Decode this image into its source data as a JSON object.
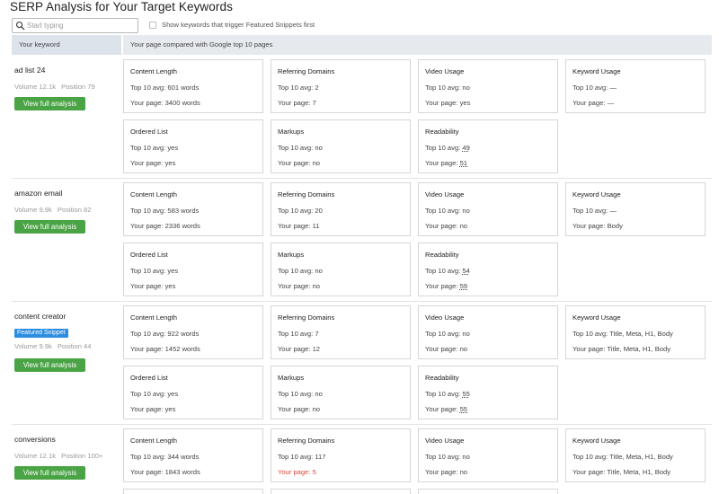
{
  "page": {
    "title": "SERP Analysis for Your Target Keywords",
    "search_placeholder": "Start typing",
    "featured_checkbox_label": "Show keywords that trigger Featured Snippets first"
  },
  "table_header": {
    "left": "Your keyword",
    "right": "Your page compared with Google top 10 pages"
  },
  "button_label": "View full analysis",
  "keywords": [
    {
      "name": "ad list 24",
      "volume": "Volume 12.1k",
      "position": "Position 79",
      "badge": "",
      "metrics": {
        "content_length": {
          "title": "Content Length",
          "avg": "Top 10 avg: 601 words",
          "page": "Your page: 3400 words"
        },
        "referring_domains": {
          "title": "Referring Domains",
          "avg": "Top 10 avg: 2",
          "page": "Your page: 7"
        },
        "video_usage": {
          "title": "Video Usage",
          "avg": "Top 10 avg: no",
          "page": "Your page: yes"
        },
        "keyword_usage": {
          "title": "Keyword Usage",
          "avg": "Top 10 avg: —",
          "page": "Your page: —"
        },
        "ordered_list": {
          "title": "Ordered List",
          "avg": "Top 10 avg: yes",
          "page": "Your page: yes"
        },
        "markups": {
          "title": "Markups",
          "avg": "Top 10 avg: no",
          "page": "Your page: no"
        },
        "readability": {
          "title": "Readability",
          "avg_prefix": "Top 10 avg: ",
          "avg_value": "49",
          "page_prefix": "Your page: ",
          "page_value": "51"
        }
      }
    },
    {
      "name": "amazon email",
      "volume": "Volume 9.9k",
      "position": "Position 82",
      "badge": "",
      "metrics": {
        "content_length": {
          "title": "Content Length",
          "avg": "Top 10 avg: 583 words",
          "page": "Your page: 2336 words"
        },
        "referring_domains": {
          "title": "Referring Domains",
          "avg": "Top 10 avg: 20",
          "page": "Your page: 11"
        },
        "video_usage": {
          "title": "Video Usage",
          "avg": "Top 10 avg: no",
          "page": "Your page: no"
        },
        "keyword_usage": {
          "title": "Keyword Usage",
          "avg": "Top 10 avg: —",
          "page": "Your page: Body"
        },
        "ordered_list": {
          "title": "Ordered List",
          "avg": "Top 10 avg: yes",
          "page": "Your page: yes"
        },
        "markups": {
          "title": "Markups",
          "avg": "Top 10 avg: no",
          "page": "Your page: no"
        },
        "readability": {
          "title": "Readability",
          "avg_prefix": "Top 10 avg: ",
          "avg_value": "54",
          "page_prefix": "Your page: ",
          "page_value": "59"
        }
      }
    },
    {
      "name": "content creator",
      "volume": "Volume 9.9k",
      "position": "Position 44",
      "badge": "Featured Snippet",
      "metrics": {
        "content_length": {
          "title": "Content Length",
          "avg": "Top 10 avg: 922 words",
          "page": "Your page: 1452 words"
        },
        "referring_domains": {
          "title": "Referring Domains",
          "avg": "Top 10 avg: 7",
          "page": "Your page: 12"
        },
        "video_usage": {
          "title": "Video Usage",
          "avg": "Top 10 avg: no",
          "page": "Your page: no"
        },
        "keyword_usage": {
          "title": "Keyword Usage",
          "avg": "Top 10 avg: Title, Meta, H1, Body",
          "page": "Your page: Title, Meta, H1, Body"
        },
        "ordered_list": {
          "title": "Ordered List",
          "avg": "Top 10 avg: yes",
          "page": "Your page: yes"
        },
        "markups": {
          "title": "Markups",
          "avg": "Top 10 avg: no",
          "page": "Your page: no"
        },
        "readability": {
          "title": "Readability",
          "avg_prefix": "Top 10 avg: ",
          "avg_value": "55",
          "page_prefix": "Your page: ",
          "page_value": "55"
        }
      }
    },
    {
      "name": "conversions",
      "volume": "Volume 12.1k",
      "position": "Position 100+",
      "badge": "",
      "metrics": {
        "content_length": {
          "title": "Content Length",
          "avg": "Top 10 avg: 344 words",
          "page": "Your page: 1843 words"
        },
        "referring_domains": {
          "title": "Referring Domains",
          "avg": "Top 10 avg: 117",
          "page": "Your page: 5"
        },
        "video_usage": {
          "title": "Video Usage",
          "avg": "Top 10 avg: no",
          "page": "Your page: no"
        },
        "keyword_usage": {
          "title": "Keyword Usage",
          "avg": "Top 10 avg: Title, Meta, H1, Body",
          "page": "Your page: Title, Meta, H1, Body"
        }
      }
    }
  ],
  "colors": {
    "button_green": "#4aa345",
    "badge_blue": "#2d8ee0",
    "warning_red": "#e0483a",
    "header_bg": "#e6eaef"
  }
}
